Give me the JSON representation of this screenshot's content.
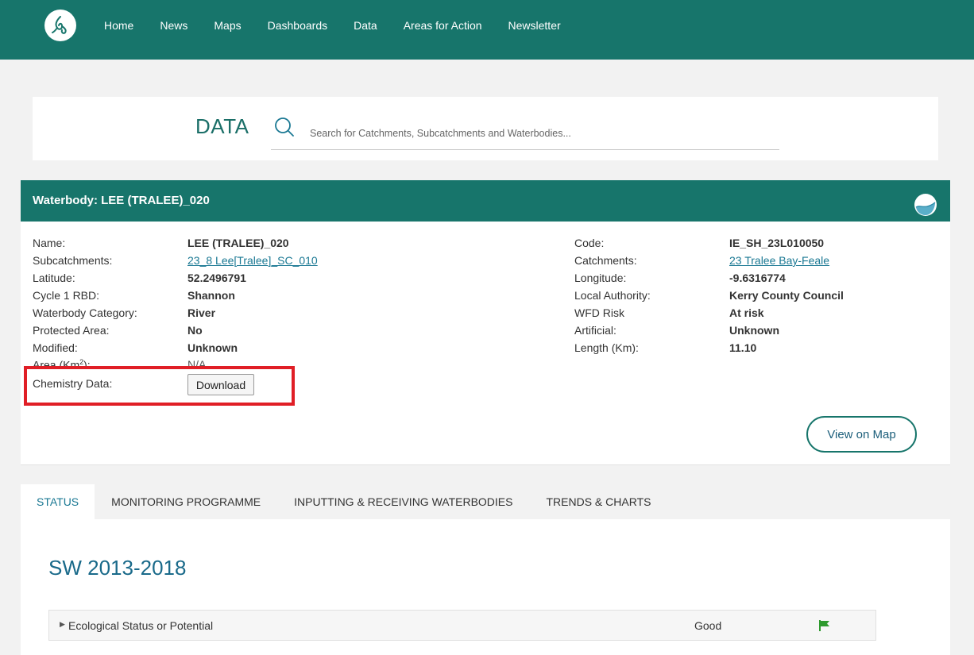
{
  "nav": {
    "items": [
      "Home",
      "News",
      "Maps",
      "Dashboards",
      "Data",
      "Areas for Action",
      "Newsletter"
    ]
  },
  "search": {
    "title": "DATA",
    "placeholder": "Search for Catchments, Subcatchments and Waterbodies..."
  },
  "waterbody": {
    "header": "Waterbody: LEE (TRALEE)_020",
    "left": {
      "name_label": "Name:",
      "name_value": "LEE (TRALEE)_020",
      "subcatchments_label": "Subcatchments:",
      "subcatchments_value": "23_8 Lee[Tralee]_SC_010",
      "latitude_label": "Latitude:",
      "latitude_value": "52.2496791",
      "rbd_label": "Cycle 1 RBD:",
      "rbd_value": "Shannon",
      "category_label": "Waterbody Category:",
      "category_value": "River",
      "protected_label": "Protected Area:",
      "protected_value": "No",
      "modified_label": "Modified:",
      "modified_value": "Unknown",
      "area_label_prefix": "Area (Km",
      "area_label_sup": "2",
      "area_label_suffix": "):",
      "area_value": "N/A",
      "chemistry_label": "Chemistry Data:",
      "download_label": "Download"
    },
    "right": {
      "code_label": "Code:",
      "code_value": "IE_SH_23L010050",
      "catchments_label": "Catchments:",
      "catchments_value": "23 Tralee Bay-Feale",
      "longitude_label": "Longitude:",
      "longitude_value": "-9.6316774",
      "authority_label": "Local Authority:",
      "authority_value": "Kerry County Council",
      "wfd_label": "WFD Risk",
      "wfd_value": "At risk",
      "artificial_label": "Artificial:",
      "artificial_value": "Unknown",
      "length_label": "Length (Km):",
      "length_value": "11.10"
    },
    "map_button": "View on Map"
  },
  "tabs": [
    "STATUS",
    "MONITORING PROGRAMME",
    "INPUTTING & RECEIVING WATERBODIES",
    "TRENDS & CHARTS"
  ],
  "status": {
    "period": "SW 2013-2018",
    "rows": [
      {
        "label": "Ecological Status or Potential",
        "value": "Good",
        "flag_color": "#2e9a2e"
      }
    ]
  },
  "colors": {
    "brand": "#17756b",
    "link": "#1a7893",
    "highlight": "#e01e26"
  }
}
